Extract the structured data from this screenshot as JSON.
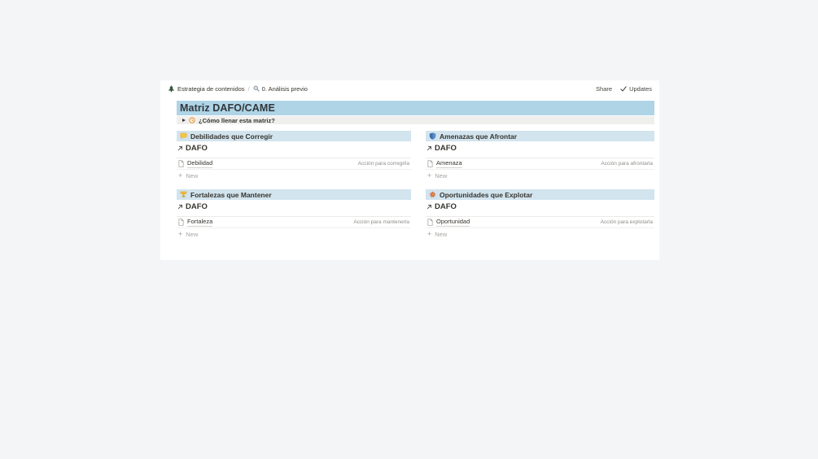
{
  "colors": {
    "page_bg": "#f4f5f6",
    "card_bg": "#ffffff",
    "title_bar_bg": "#aed4e6",
    "section_header_bg": "#d2e4ee",
    "toggle_bg": "#efefed",
    "text_dark": "#37352f",
    "text_gray": "#8f8e8a",
    "text_light_gray": "#a5a49f",
    "divider": "#ebeae8"
  },
  "topbar": {
    "crumb1": "Estrategia de contenidos",
    "separator": "/",
    "crumb2": "0. Análisis previo",
    "share": "Share",
    "updates": "Updates"
  },
  "page": {
    "title": "Matriz DAFO/CAME",
    "toggle_label": "¿Cómo llenar esta matriz?"
  },
  "icons": {
    "plus": "+"
  },
  "quadrants": [
    {
      "title": "Debilidades que Corregir",
      "db_title": "DAFO",
      "row_title": "Debilidad",
      "row_property": "Acción para corregirla",
      "new_label": "New"
    },
    {
      "title": "Amenazas que Afrontar",
      "db_title": "DAFO",
      "row_title": "Amenaza",
      "row_property": "Acción para afrontarla",
      "new_label": "New"
    },
    {
      "title": "Fortalezas que Mantener",
      "db_title": "DAFO",
      "row_title": "Fortaleza",
      "row_property": "Acción para mantenerla",
      "new_label": "New"
    },
    {
      "title": "Oportunidades que Explotar",
      "db_title": "DAFO",
      "row_title": "Oportunidad",
      "row_property": "Acción para explotarla",
      "new_label": "New"
    }
  ]
}
